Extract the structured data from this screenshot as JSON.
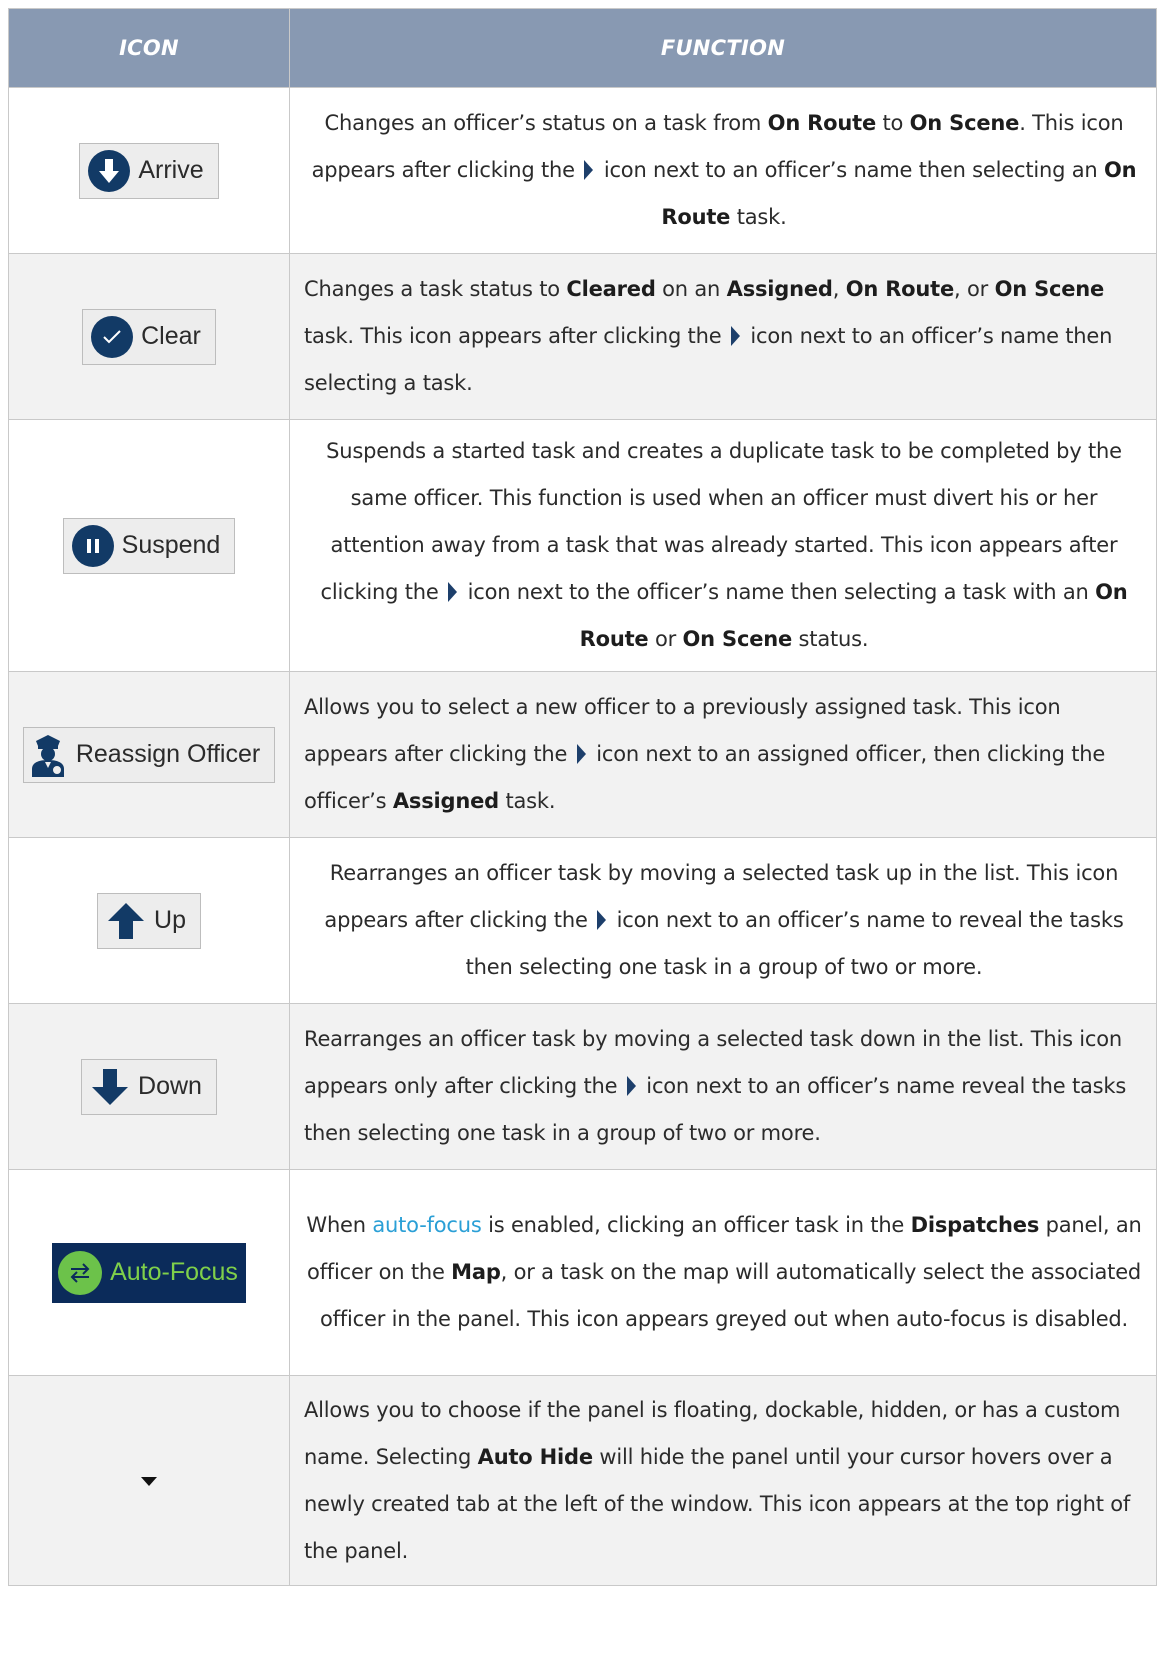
{
  "header": {
    "icon_col": "ICON",
    "function_col": "FUNCTION"
  },
  "rows": [
    {
      "button": {
        "label": "Arrive",
        "icon": "arrow-down-circle-icon"
      },
      "f": [
        "Changes an officer’s status on a task from ",
        "On Route",
        " to ",
        "On Scene",
        ". This icon appears after clicking the ",
        " icon next to an officer’s name then selecting an ",
        "On Route",
        " task."
      ]
    },
    {
      "button": {
        "label": "Clear",
        "icon": "check-circle-icon"
      },
      "f": [
        "Changes a task status to ",
        "Cleared",
        " on an ",
        "Assigned",
        ", ",
        "On Route",
        ", or ",
        "On Scene",
        " task. This icon appears after clicking the ",
        " icon next to an officer’s name then selecting a task."
      ]
    },
    {
      "button": {
        "label": "Suspend",
        "icon": "pause-circle-icon"
      },
      "f": [
        "Suspends a started task and creates a duplicate task to be completed by the same officer. This function is used when an officer must divert his or her attention away from a task that was already started. This icon appears after clicking the ",
        " icon next to the officer’s name then selecting a task with an ",
        "On Route",
        " or ",
        "On Scene",
        " status."
      ]
    },
    {
      "button": {
        "label": "Reassign Officer",
        "icon": "police-officer-icon"
      },
      "f": [
        "Allows you to select a new officer to a previously assigned task. This icon appears after clicking the ",
        " icon next to an assigned officer, then clicking the officer’s ",
        "Assigned",
        " task."
      ]
    },
    {
      "button": {
        "label": "Up",
        "icon": "arrow-up-icon"
      },
      "f": [
        "Rearranges an officer task by moving a selected task up in the list. This icon appears after clicking the ",
        " icon next to an officer’s name to reveal the tasks then selecting one task in a group of two or more."
      ]
    },
    {
      "button": {
        "label": "Down",
        "icon": "arrow-down-icon"
      },
      "f": [
        "Rearranges an officer task by moving a selected task down in the list. This icon appears only after clicking the ",
        " icon next to an officer’s name reveal the tasks then selecting one task in a group of two or more."
      ]
    },
    {
      "button": {
        "label": "Auto-Focus",
        "icon": "swap-arrows-icon"
      },
      "f": [
        "When ",
        "auto-focus",
        " is enabled, clicking an officer task in the ",
        "Dispatches",
        " panel, an officer on the ",
        "Map",
        ", or a task on the map will automatically select the associated officer in the panel. This icon appears greyed out when auto-focus is disabled."
      ]
    },
    {
      "button": {
        "icon": "caret-down-icon"
      },
      "f": [
        "Allows you to choose if the panel is floating, dockable, hidden, or has a custom name. Selecting ",
        "Auto Hide",
        " will hide the panel until your cursor hovers over a newly created tab at the left of the window. This icon appears at the top right of the panel."
      ]
    }
  ],
  "colors": {
    "header_bg": "#8899b2",
    "icon_navy": "#123a66",
    "link": "#2a9fd6",
    "autofocus_bg": "#0b2b5a",
    "autofocus_green": "#6cc24a"
  }
}
